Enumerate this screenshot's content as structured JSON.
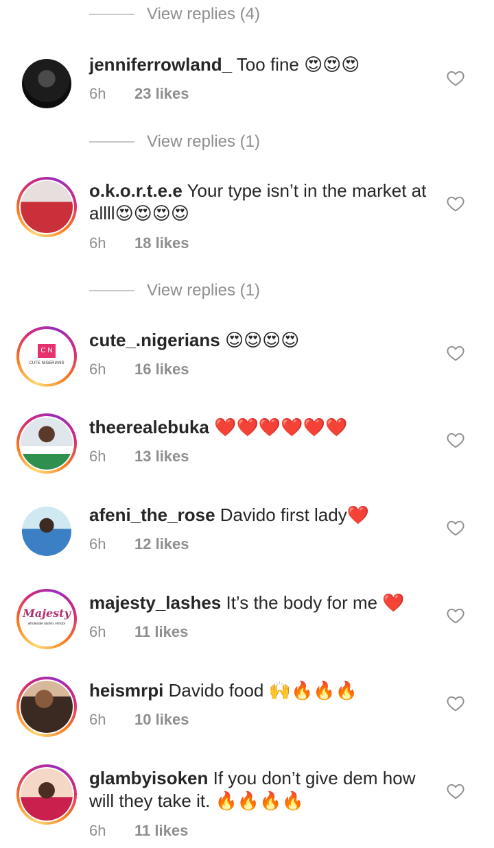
{
  "view_replies": [
    {
      "label": "View replies (4)"
    },
    {
      "label": "View replies (1)"
    },
    {
      "label": "View replies (1)"
    }
  ],
  "comments": [
    {
      "username": "jenniferrowland_",
      "text": " Too fine 😍😍😍",
      "time": "6h",
      "likes": "23 likes"
    },
    {
      "username": "o.k.o.r.t.e.e",
      "text": " Your type isn’t in the market at allll😍😍😍😍",
      "time": "6h",
      "likes": "18 likes"
    },
    {
      "username": "cute_.nigerians",
      "text": " 😍😍😍😍",
      "time": "6h",
      "likes": "16 likes",
      "avatar_text": "C N",
      "avatar_subtext": "CUTE NIGERIANS"
    },
    {
      "username": "theerealebuka",
      "text": " ❤️❤️❤️❤️❤️❤️",
      "time": "6h",
      "likes": "13 likes"
    },
    {
      "username": "afeni_the_rose",
      "text": " Davido first lady❤️",
      "time": "6h",
      "likes": "12 likes"
    },
    {
      "username": "majesty_lashes",
      "text": " It’s the body for me ❤️",
      "time": "6h",
      "likes": "11 likes",
      "avatar_text": "Majesty",
      "avatar_subtext": "wholesale lashes vendor"
    },
    {
      "username": "heismrpi",
      "text": " Davido food 🙌🔥🔥🔥",
      "time": "6h",
      "likes": "10 likes"
    },
    {
      "username": "glambyisoken",
      "text": " If you don’t give dem how will they take it. 🔥🔥🔥🔥",
      "time": "6h",
      "likes": "11 likes"
    }
  ],
  "colors": {
    "accent_ring_start": "#feda75",
    "accent_ring_mid": "#d62976",
    "muted": "#8e8e8e",
    "text": "#262626"
  },
  "icons": {
    "like": "heart-outline-icon"
  }
}
